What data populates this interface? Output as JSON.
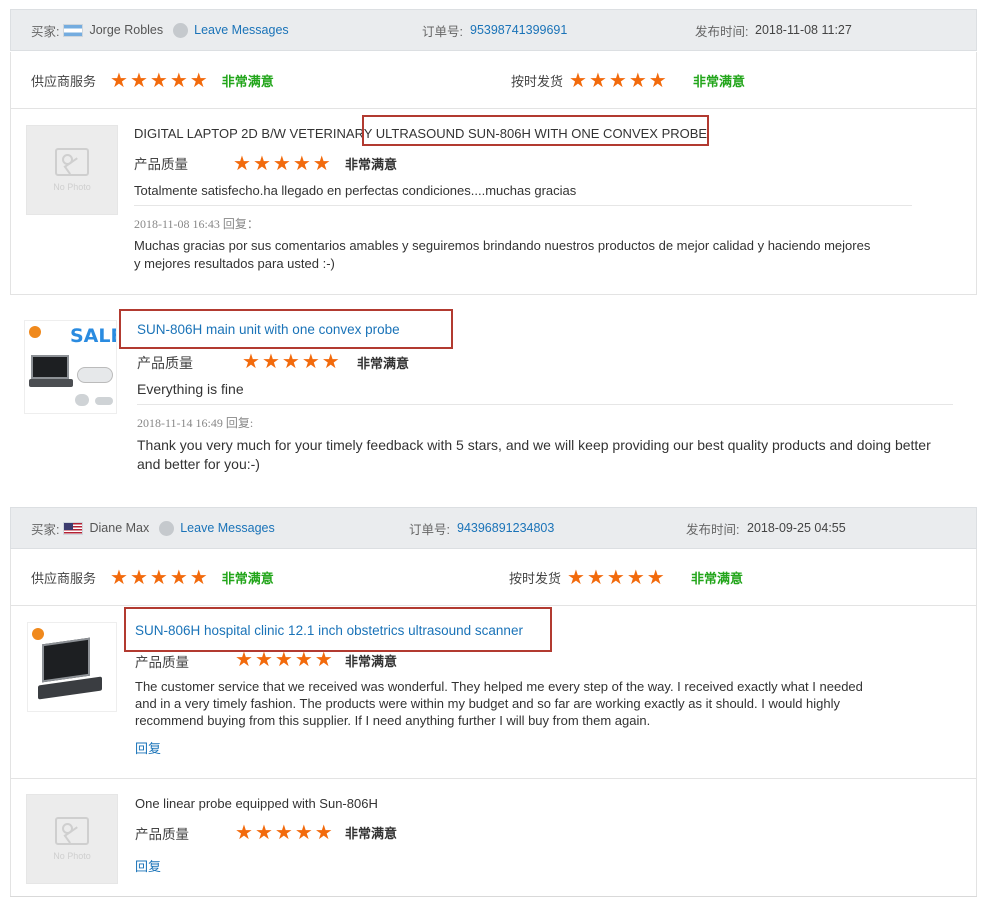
{
  "review1": {
    "buyer_label": "买家:",
    "buyer_name": "Jorge Robles",
    "leave_messages": "Leave Messages",
    "order_label": "订单号:",
    "order_no": "95398741399691",
    "date_label": "发布时间:",
    "date": "2018-11-08 11:27",
    "supplier_service_label": "供应商服务",
    "supplier_service_rating": "非常满意",
    "ontime_label": "按时发货",
    "ontime_rating": "非常满意",
    "items": [
      {
        "title": "DIGITAL LAPTOP 2D B/W VETERINARY ULTRASOUND SUN-806H WITH ONE CONVEX PROBE",
        "quality_label": "产品质量",
        "quality_rating": "非常满意",
        "comment": "Totalmente satisfecho.ha llegado en perfectas condiciones....muchas gracias",
        "reply_meta": "2018-11-08 16:43   回复：",
        "reply_line1": "Muchas gracias por sus comentarios amables y seguiremos brindando nuestros productos de mejor calidad y haciendo mejores",
        "reply_line2": "y mejores resultados para usted :-)",
        "thumb_text": "No Photo"
      },
      {
        "title": "SUN-806H main unit with one convex probe",
        "quality_label": "产品质量",
        "quality_rating": "非常满意",
        "comment": "Everything is fine",
        "reply_meta": "2018-11-14 16:49       回复:",
        "reply_line1": "Thank you very much for your timely feedback with 5 stars, and we will keep providing our best quality products and doing better",
        "reply_line2": "and better for you:-)",
        "sale_badge": "SALE"
      }
    ]
  },
  "review2": {
    "buyer_label": "买家:",
    "buyer_name": "Diane Max",
    "leave_messages": "Leave Messages",
    "order_label": "订单号:",
    "order_no": "94396891234803",
    "date_label": "发布时间:",
    "date": "2018-09-25 04:55",
    "supplier_service_label": "供应商服务",
    "supplier_service_rating": "非常满意",
    "ontime_label": "按时发货",
    "ontime_rating": "非常满意",
    "items": [
      {
        "title": "SUN-806H hospital clinic 12.1 inch obstetrics ultrasound scanner",
        "quality_label": "产品质量",
        "quality_rating": "非常满意",
        "comment_line1": "The customer service that we received was wonderful. They helped me every step of the way. I received exactly what I needed",
        "comment_line2": "and in a very timely fashion. The products were within my budget and so far are working exactly as it should. I would highly",
        "comment_line3": "recommend buying from this supplier. If I need anything further I will buy from them again.",
        "reply_link": "回复"
      },
      {
        "title": "One linear probe equipped with Sun-806H",
        "quality_label": "产品质量",
        "quality_rating": "非常满意",
        "reply_link": "回复",
        "thumb_text": "No Photo"
      }
    ]
  },
  "star_count": 5,
  "colors": {
    "star": "#f26a0c",
    "satisfied": "#22a51a",
    "link": "#1a73b8",
    "highlight_box": "#b23a30"
  }
}
